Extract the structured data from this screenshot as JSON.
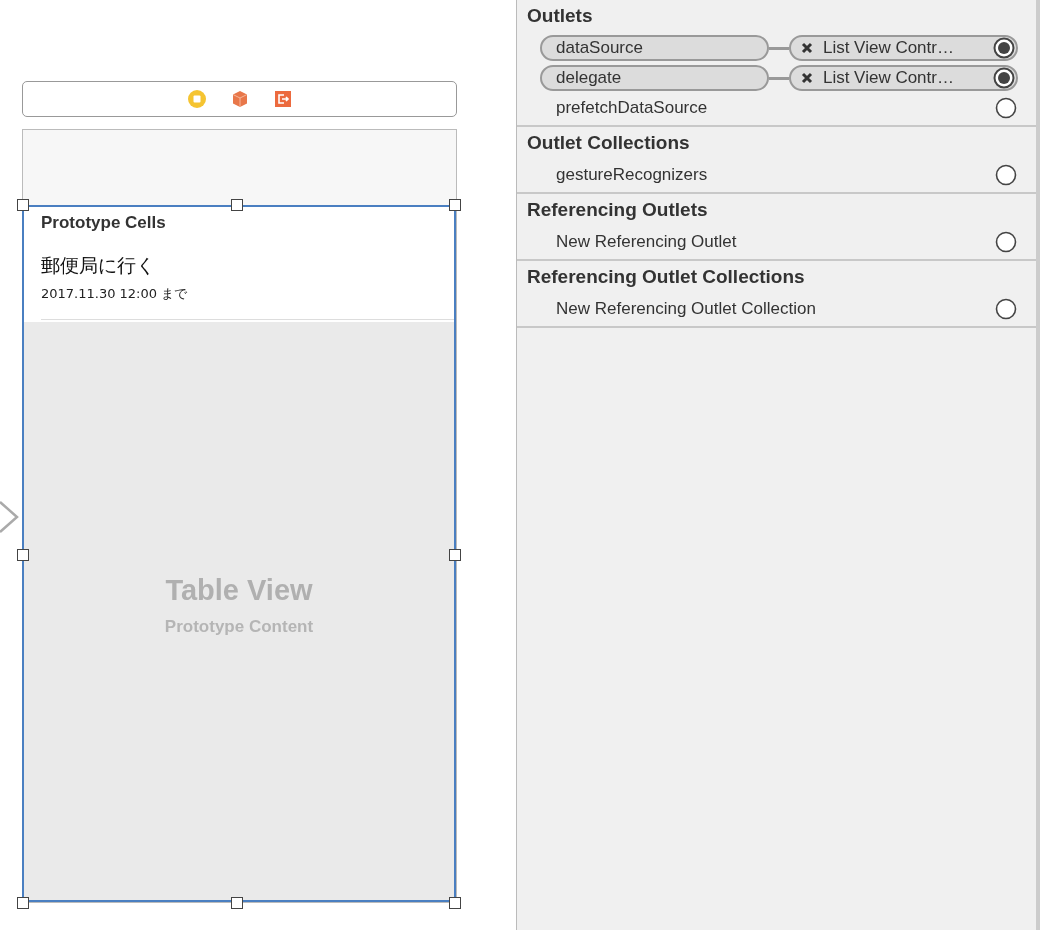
{
  "canvas": {
    "table_view": {
      "selected": true,
      "section_header": "Prototype Cells",
      "cell": {
        "title": "郵便局に行く",
        "subtitle": "2017.11.30 12:00 まで"
      },
      "placeholder_title": "Table View",
      "placeholder_subtitle": "Prototype Content"
    }
  },
  "connections": [
    {
      "title": "Outlets",
      "items": [
        {
          "name": "dataSource",
          "connected": true,
          "target": "List View Contr…"
        },
        {
          "name": "delegate",
          "connected": true,
          "target": "List View Contr…"
        },
        {
          "name": "prefetchDataSource",
          "connected": false
        }
      ]
    },
    {
      "title": "Outlet Collections",
      "items": [
        {
          "name": "gestureRecognizers",
          "connected": false
        }
      ]
    },
    {
      "title": "Referencing Outlets",
      "items": [
        {
          "name": "New Referencing Outlet",
          "connected": false
        }
      ]
    },
    {
      "title": "Referencing Outlet Collections",
      "items": [
        {
          "name": "New Referencing Outlet Collection",
          "connected": false
        }
      ]
    }
  ]
}
